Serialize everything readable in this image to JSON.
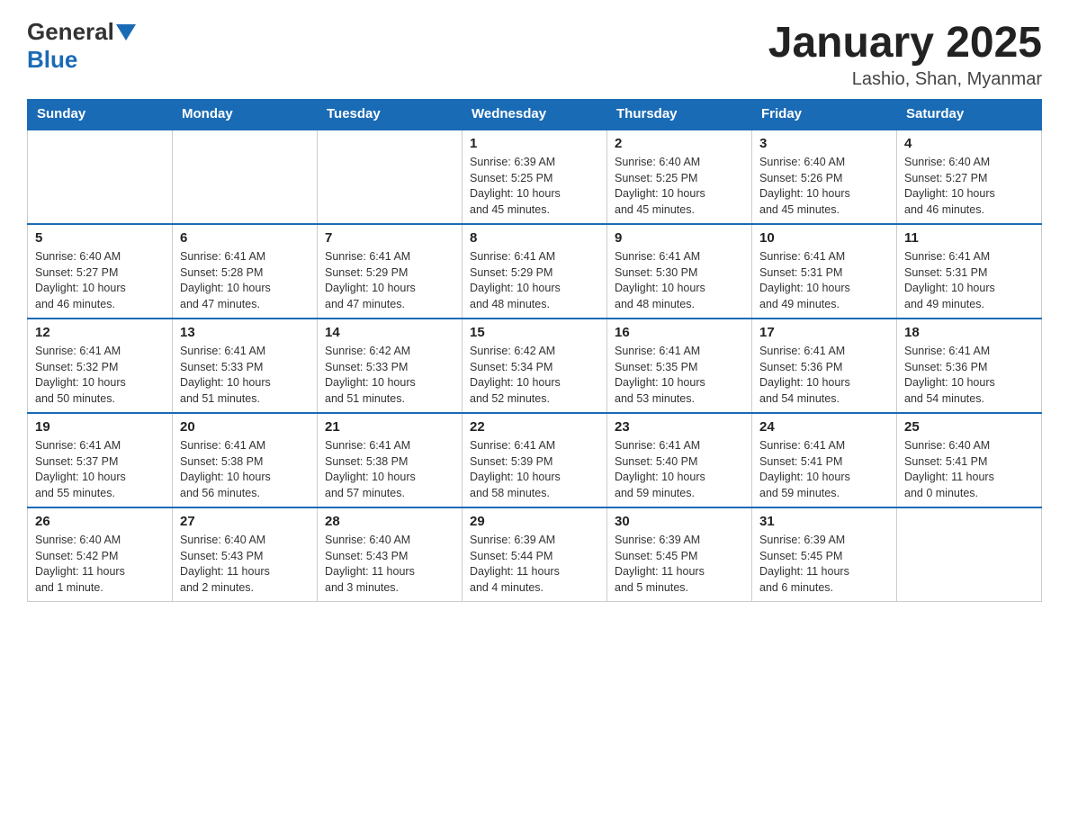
{
  "header": {
    "logo": {
      "text_general": "General",
      "text_blue": "Blue",
      "arrow_label": "GeneralBlue logo arrow"
    },
    "title": "January 2025",
    "location": "Lashio, Shan, Myanmar"
  },
  "calendar": {
    "days_of_week": [
      "Sunday",
      "Monday",
      "Tuesday",
      "Wednesday",
      "Thursday",
      "Friday",
      "Saturday"
    ],
    "weeks": [
      [
        {
          "day": "",
          "info": ""
        },
        {
          "day": "",
          "info": ""
        },
        {
          "day": "",
          "info": ""
        },
        {
          "day": "1",
          "info": "Sunrise: 6:39 AM\nSunset: 5:25 PM\nDaylight: 10 hours\nand 45 minutes."
        },
        {
          "day": "2",
          "info": "Sunrise: 6:40 AM\nSunset: 5:25 PM\nDaylight: 10 hours\nand 45 minutes."
        },
        {
          "day": "3",
          "info": "Sunrise: 6:40 AM\nSunset: 5:26 PM\nDaylight: 10 hours\nand 45 minutes."
        },
        {
          "day": "4",
          "info": "Sunrise: 6:40 AM\nSunset: 5:27 PM\nDaylight: 10 hours\nand 46 minutes."
        }
      ],
      [
        {
          "day": "5",
          "info": "Sunrise: 6:40 AM\nSunset: 5:27 PM\nDaylight: 10 hours\nand 46 minutes."
        },
        {
          "day": "6",
          "info": "Sunrise: 6:41 AM\nSunset: 5:28 PM\nDaylight: 10 hours\nand 47 minutes."
        },
        {
          "day": "7",
          "info": "Sunrise: 6:41 AM\nSunset: 5:29 PM\nDaylight: 10 hours\nand 47 minutes."
        },
        {
          "day": "8",
          "info": "Sunrise: 6:41 AM\nSunset: 5:29 PM\nDaylight: 10 hours\nand 48 minutes."
        },
        {
          "day": "9",
          "info": "Sunrise: 6:41 AM\nSunset: 5:30 PM\nDaylight: 10 hours\nand 48 minutes."
        },
        {
          "day": "10",
          "info": "Sunrise: 6:41 AM\nSunset: 5:31 PM\nDaylight: 10 hours\nand 49 minutes."
        },
        {
          "day": "11",
          "info": "Sunrise: 6:41 AM\nSunset: 5:31 PM\nDaylight: 10 hours\nand 49 minutes."
        }
      ],
      [
        {
          "day": "12",
          "info": "Sunrise: 6:41 AM\nSunset: 5:32 PM\nDaylight: 10 hours\nand 50 minutes."
        },
        {
          "day": "13",
          "info": "Sunrise: 6:41 AM\nSunset: 5:33 PM\nDaylight: 10 hours\nand 51 minutes."
        },
        {
          "day": "14",
          "info": "Sunrise: 6:42 AM\nSunset: 5:33 PM\nDaylight: 10 hours\nand 51 minutes."
        },
        {
          "day": "15",
          "info": "Sunrise: 6:42 AM\nSunset: 5:34 PM\nDaylight: 10 hours\nand 52 minutes."
        },
        {
          "day": "16",
          "info": "Sunrise: 6:41 AM\nSunset: 5:35 PM\nDaylight: 10 hours\nand 53 minutes."
        },
        {
          "day": "17",
          "info": "Sunrise: 6:41 AM\nSunset: 5:36 PM\nDaylight: 10 hours\nand 54 minutes."
        },
        {
          "day": "18",
          "info": "Sunrise: 6:41 AM\nSunset: 5:36 PM\nDaylight: 10 hours\nand 54 minutes."
        }
      ],
      [
        {
          "day": "19",
          "info": "Sunrise: 6:41 AM\nSunset: 5:37 PM\nDaylight: 10 hours\nand 55 minutes."
        },
        {
          "day": "20",
          "info": "Sunrise: 6:41 AM\nSunset: 5:38 PM\nDaylight: 10 hours\nand 56 minutes."
        },
        {
          "day": "21",
          "info": "Sunrise: 6:41 AM\nSunset: 5:38 PM\nDaylight: 10 hours\nand 57 minutes."
        },
        {
          "day": "22",
          "info": "Sunrise: 6:41 AM\nSunset: 5:39 PM\nDaylight: 10 hours\nand 58 minutes."
        },
        {
          "day": "23",
          "info": "Sunrise: 6:41 AM\nSunset: 5:40 PM\nDaylight: 10 hours\nand 59 minutes."
        },
        {
          "day": "24",
          "info": "Sunrise: 6:41 AM\nSunset: 5:41 PM\nDaylight: 10 hours\nand 59 minutes."
        },
        {
          "day": "25",
          "info": "Sunrise: 6:40 AM\nSunset: 5:41 PM\nDaylight: 11 hours\nand 0 minutes."
        }
      ],
      [
        {
          "day": "26",
          "info": "Sunrise: 6:40 AM\nSunset: 5:42 PM\nDaylight: 11 hours\nand 1 minute."
        },
        {
          "day": "27",
          "info": "Sunrise: 6:40 AM\nSunset: 5:43 PM\nDaylight: 11 hours\nand 2 minutes."
        },
        {
          "day": "28",
          "info": "Sunrise: 6:40 AM\nSunset: 5:43 PM\nDaylight: 11 hours\nand 3 minutes."
        },
        {
          "day": "29",
          "info": "Sunrise: 6:39 AM\nSunset: 5:44 PM\nDaylight: 11 hours\nand 4 minutes."
        },
        {
          "day": "30",
          "info": "Sunrise: 6:39 AM\nSunset: 5:45 PM\nDaylight: 11 hours\nand 5 minutes."
        },
        {
          "day": "31",
          "info": "Sunrise: 6:39 AM\nSunset: 5:45 PM\nDaylight: 11 hours\nand 6 minutes."
        },
        {
          "day": "",
          "info": ""
        }
      ]
    ]
  }
}
